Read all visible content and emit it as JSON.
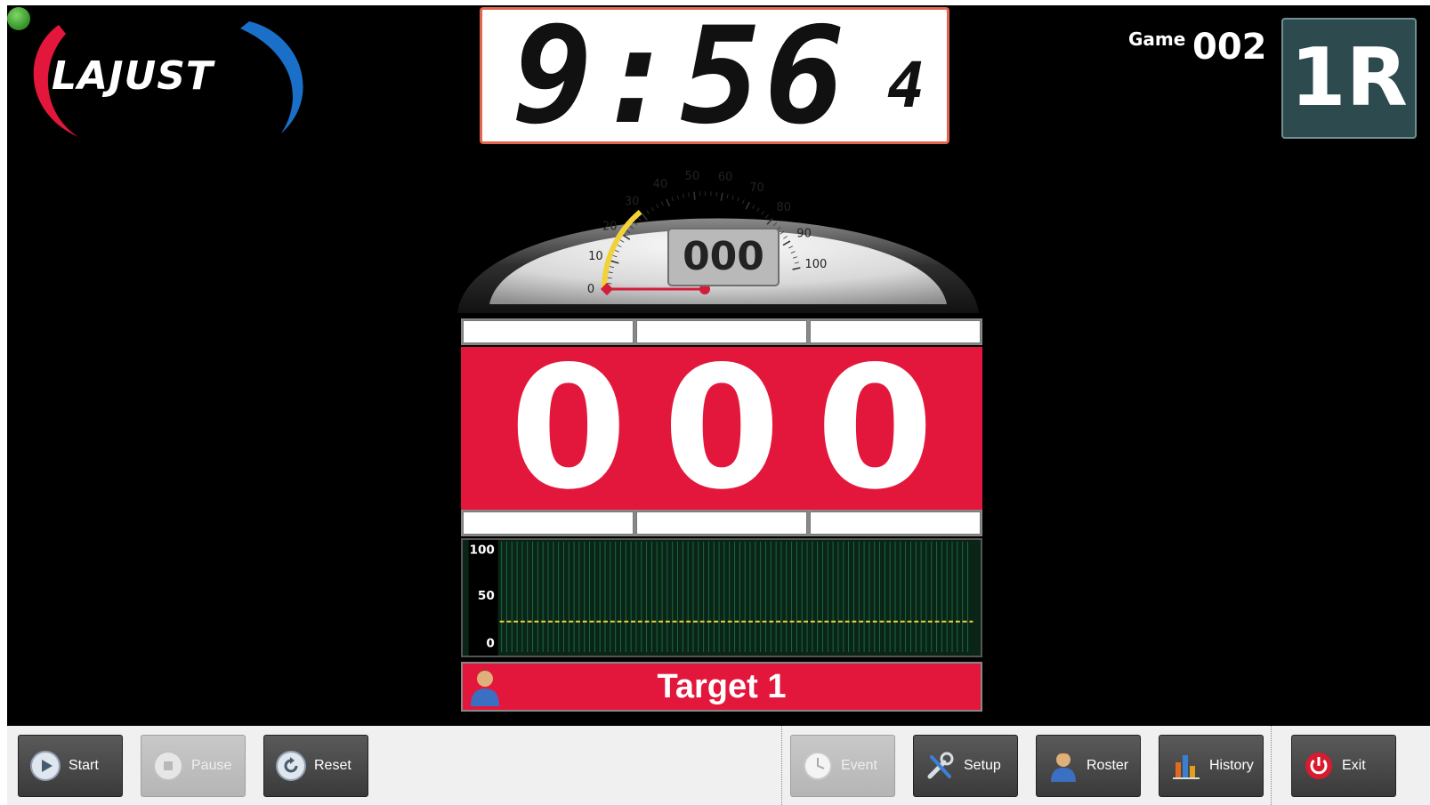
{
  "header": {
    "logo_text": "LAJUST",
    "game_label": "Game",
    "game_number": "002",
    "round": "1R"
  },
  "timer": {
    "main": "9:56",
    "tenths": "4"
  },
  "gauge": {
    "readout": "000",
    "ticks": [
      "0",
      "10",
      "20",
      "30",
      "40",
      "50",
      "60",
      "70",
      "80",
      "90",
      "100"
    ],
    "value": 0,
    "threshold": 30
  },
  "score": {
    "digits": [
      "0",
      "0",
      "0"
    ]
  },
  "history_chart": {
    "chart_data": {
      "type": "line",
      "y_ticks": [
        "100",
        "50",
        "0"
      ],
      "ylim": [
        0,
        100
      ],
      "threshold": 30,
      "values": []
    }
  },
  "target": {
    "name": "Target 1"
  },
  "toolbar": {
    "start": "Start",
    "pause": "Pause",
    "reset": "Reset",
    "event": "Event",
    "setup": "Setup",
    "roster": "Roster",
    "history": "History",
    "exit": "Exit"
  },
  "colors": {
    "accent_red": "#e3173c",
    "threshold_yellow": "#f2d23a",
    "round_badge": "#2d4b4f"
  }
}
